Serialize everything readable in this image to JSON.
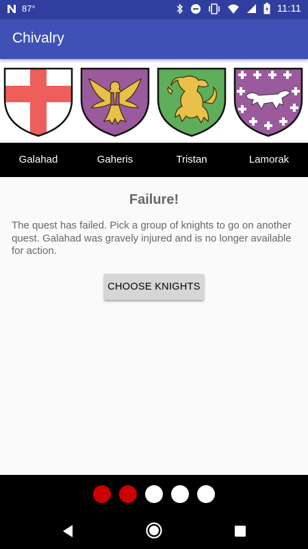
{
  "status_bar": {
    "temperature": "87°",
    "time": "11:11",
    "icons": [
      "n-logo-icon",
      "bluetooth-icon",
      "do-not-disturb-icon",
      "vibrate-icon",
      "wifi-icon",
      "signal-icon",
      "battery-icon"
    ]
  },
  "app_bar": {
    "title": "Chivalry"
  },
  "knights": [
    {
      "name": "Galahad",
      "shield": "red-cross-shield-icon"
    },
    {
      "name": "Gaheris",
      "shield": "eagle-shield-icon"
    },
    {
      "name": "Tristan",
      "shield": "lion-shield-icon"
    },
    {
      "name": "Lamorak",
      "shield": "crosslet-lion-shield-icon"
    }
  ],
  "result": {
    "heading": "Failure!",
    "message": "The quest has failed. Pick a group of knights to go on another quest. Galahad was gravely injured and is no longer available for action.",
    "button_label": "CHOOSE KNIGHTS"
  },
  "progress": {
    "total": 5,
    "failed": 2,
    "colors": {
      "failed": "#cc0000",
      "remaining": "#ffffff"
    }
  },
  "colors": {
    "primary": "#3f51b5",
    "primary_dark": "#303f9f"
  }
}
